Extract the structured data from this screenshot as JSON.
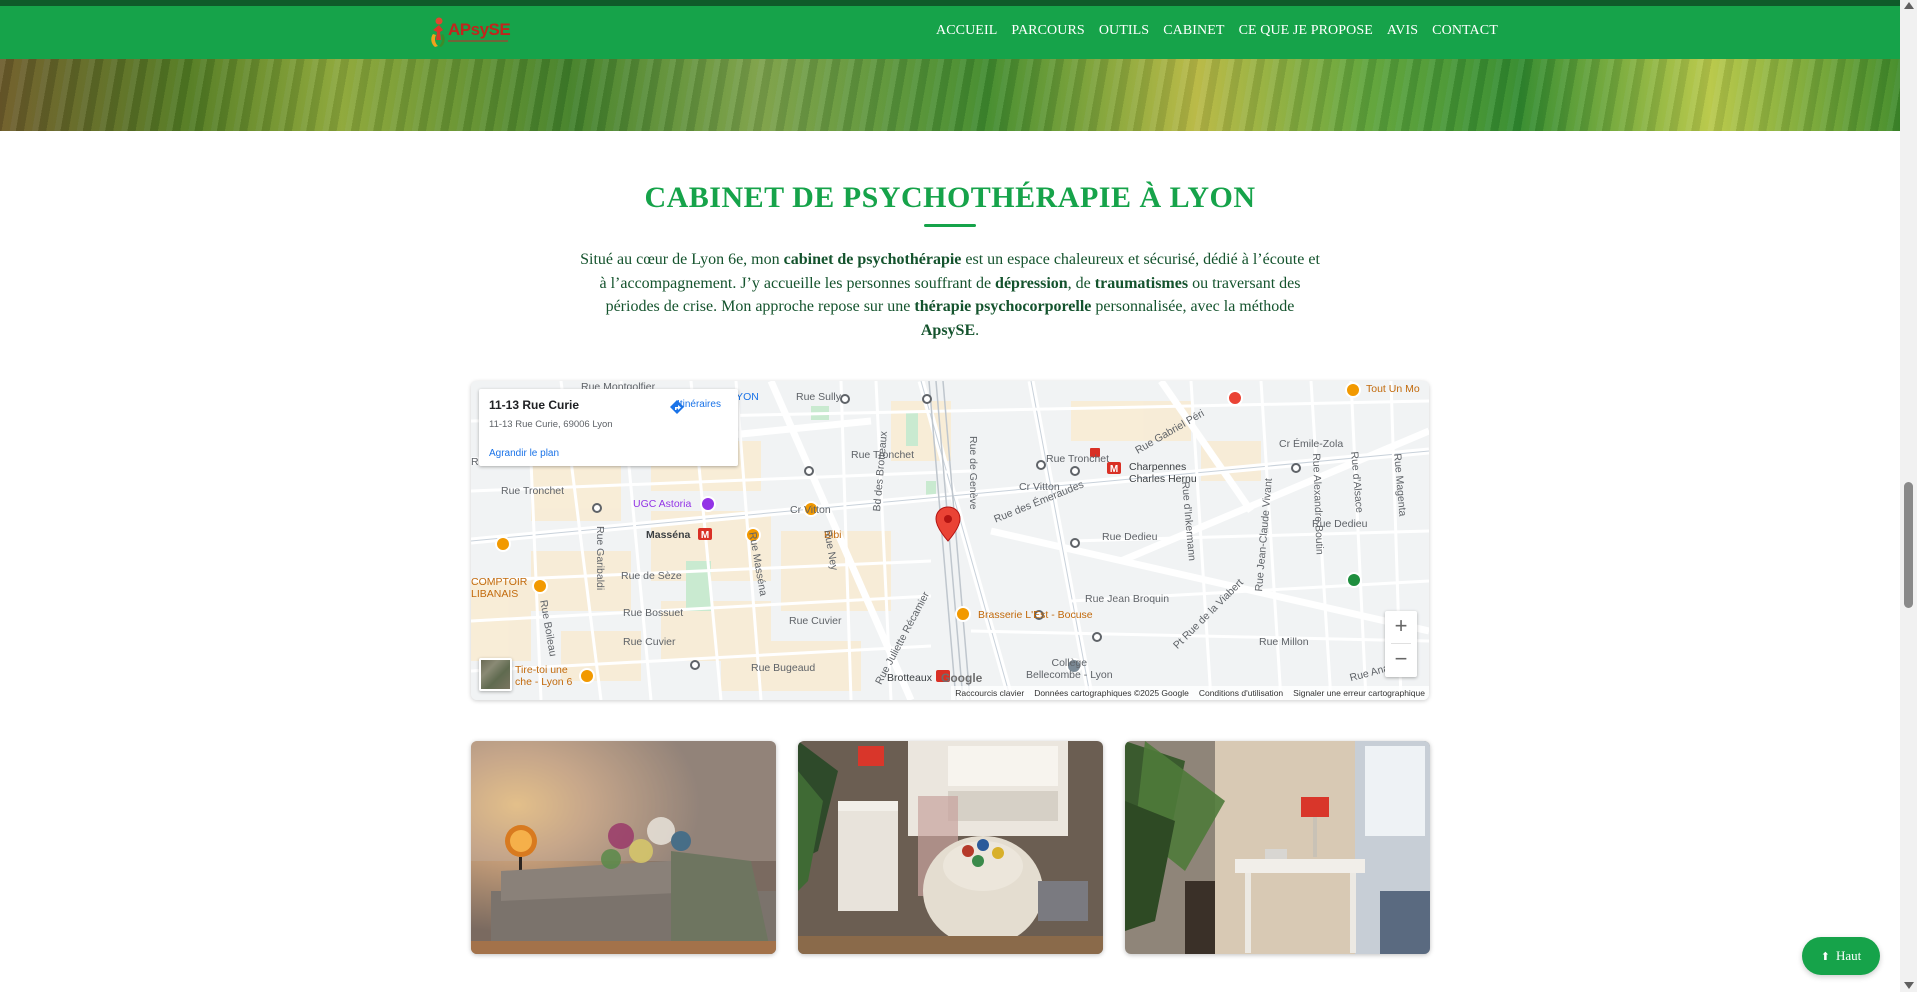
{
  "nav": {
    "logo_text": "APsySE",
    "items": [
      "ACCUEIL",
      "PARCOURS",
      "OUTILS",
      "CABINET",
      "CE QUE JE PROPOSE",
      "AVIS",
      "CONTACT"
    ]
  },
  "section": {
    "title": "CABINET DE PSYCHOTHÉRAPIE À LYON",
    "intro": {
      "p1": "Situé au cœur de Lyon 6e, mon ",
      "b1": "cabinet de psychothérapie",
      "p2": " est un espace chaleureux et sécurisé, dédié à l’écoute et à l’accompagnement. J’y accueille les personnes souffrant de ",
      "b2": "dépression",
      "p3": ", de ",
      "b3": "traumatismes",
      "p4": " ou traversant des périodes de crise. Mon approche repose sur une ",
      "b4": "thérapie psychocorporelle",
      "p5": " personnalisée, avec la méthode ",
      "b5": "ApsySE",
      "p6": "."
    }
  },
  "map": {
    "place_title": "11-13 Rue Curie",
    "place_address": "11-13 Rue Curie, 69006 Lyon",
    "enlarge_link": "Agrandir le plan",
    "directions_label": "Itinéraires",
    "zoom_in": "+",
    "zoom_out": "−",
    "google_logo": "Google",
    "footer": {
      "shortcuts": "Raccourcis clavier",
      "data": "Données cartographiques ©2025 Google",
      "terms": "Conditions d'utilisation",
      "report": "Signaler une erreur cartographique"
    },
    "labels": {
      "rue_montgolfier": "Rue Montgolfier",
      "rue_sully": "Rue Sully",
      "rue_tronchet_1": "Rue Tronchet",
      "rue_tronchet_2": "Rue Tronchet",
      "ugc_astoria": "UGC Astoria",
      "cr_vitton_1": "Cr Vitton",
      "cr_vitton_2": "Cr Vitton",
      "massena": "Masséna",
      "bibi": "Bibi",
      "rue_de_seze": "Rue de Sèze",
      "rue_bossuet": "Rue Bossuet",
      "rue_cuvier_1": "Rue Cuvier",
      "rue_cuvier_2": "Rue Cuvier",
      "rue_bugeaud": "Rue Bugeaud",
      "brotteaux": "Brotteaux",
      "brasserie": "Brasserie L'Est - Bocuse",
      "college": "Collège\nBellecombe - Lyon",
      "rue_des_emeraudes": "Rue des Émeraudes",
      "rue_dedieu_1": "Rue Dedieu",
      "rue_dedieu_2": "Rue Dedieu",
      "rue_jean_broquin": "Rue Jean Broquin",
      "charpennes": "Charpennes\nCharles Hernu",
      "cr_emile_zola": "Cr Émile-Zola",
      "tout_un_monde": "Tout Un Mo",
      "rue_millon": "Rue Millon",
      "rue_anatole": "Rue Anatole",
      "comptoir": "COMPTOIR\nLIBANAIS",
      "tire_toi": "Tire-toi une\nche - Lyon 6",
      "rue_de_geneve": "Rue de Genève",
      "rue_gabriel_peri": "Rue Gabriel Péri",
      "rue_garibaldi": "Rue Garibaldi",
      "rue_massena": "Rue Masséna",
      "rue_ney": "Rue Ney",
      "bd_brotteaux": "Bd des Brotteaux",
      "rue_juliette": "Rue Juliette Récamier",
      "rue_boileau": "Rue Boileau",
      "rue_inkermann": "Rue d'Inkermann",
      "rue_jean_claude_vivant": "Rue Jean-Claude Vivant",
      "rue_alexandre_boutin": "Rue Alexandre Boutin",
      "rue_alsace": "Rue d'Alsace",
      "rue_magenta": "Rue Magenta",
      "rue_viabert": "Pt Rue de la Viabert",
      "lyon_tl": "LYON",
      "rue_chinon": "Rue Childe"
    }
  },
  "back_to_top": {
    "label": "Haut",
    "icon": "arrow-up-icon"
  },
  "colors": {
    "brand_green": "#16a34a",
    "dark_green_text": "#14532d",
    "logo_red": "#c0261d"
  }
}
